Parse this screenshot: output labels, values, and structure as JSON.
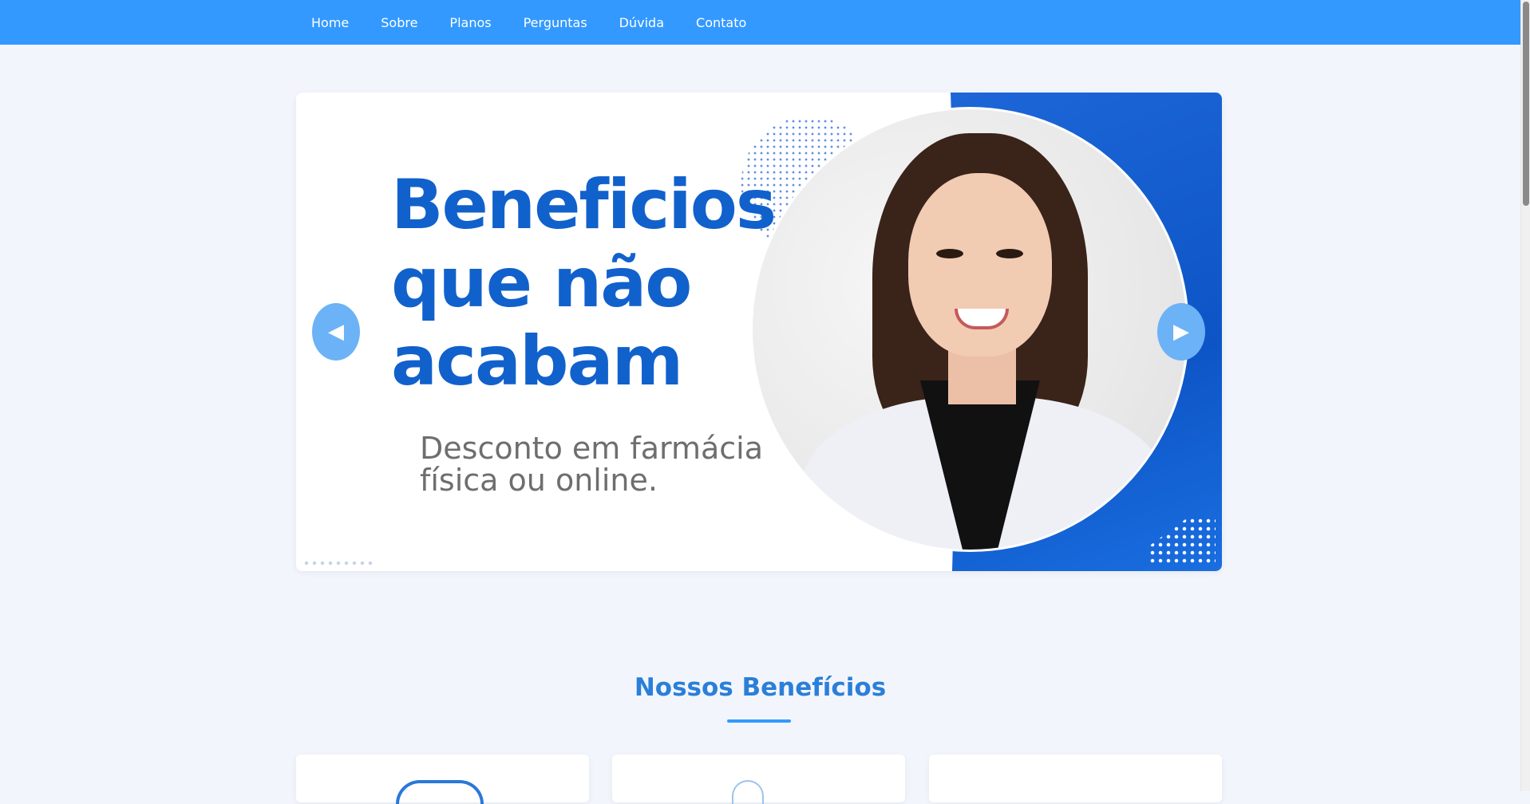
{
  "nav": {
    "items": [
      {
        "label": "Home"
      },
      {
        "label": "Sobre"
      },
      {
        "label": "Planos"
      },
      {
        "label": "Perguntas"
      },
      {
        "label": "Dúvida"
      },
      {
        "label": "Contato"
      }
    ]
  },
  "hero": {
    "title": "Beneficios que não acabam",
    "subtitle": "Desconto em farmácia física ou online.",
    "prev_arrow": "◀",
    "next_arrow": "▶"
  },
  "benefits": {
    "title": "Nossos Benefícios"
  },
  "colors": {
    "navbar": "#3399ff",
    "accent_blue": "#1161cc",
    "section_title": "#2b7fd8"
  }
}
